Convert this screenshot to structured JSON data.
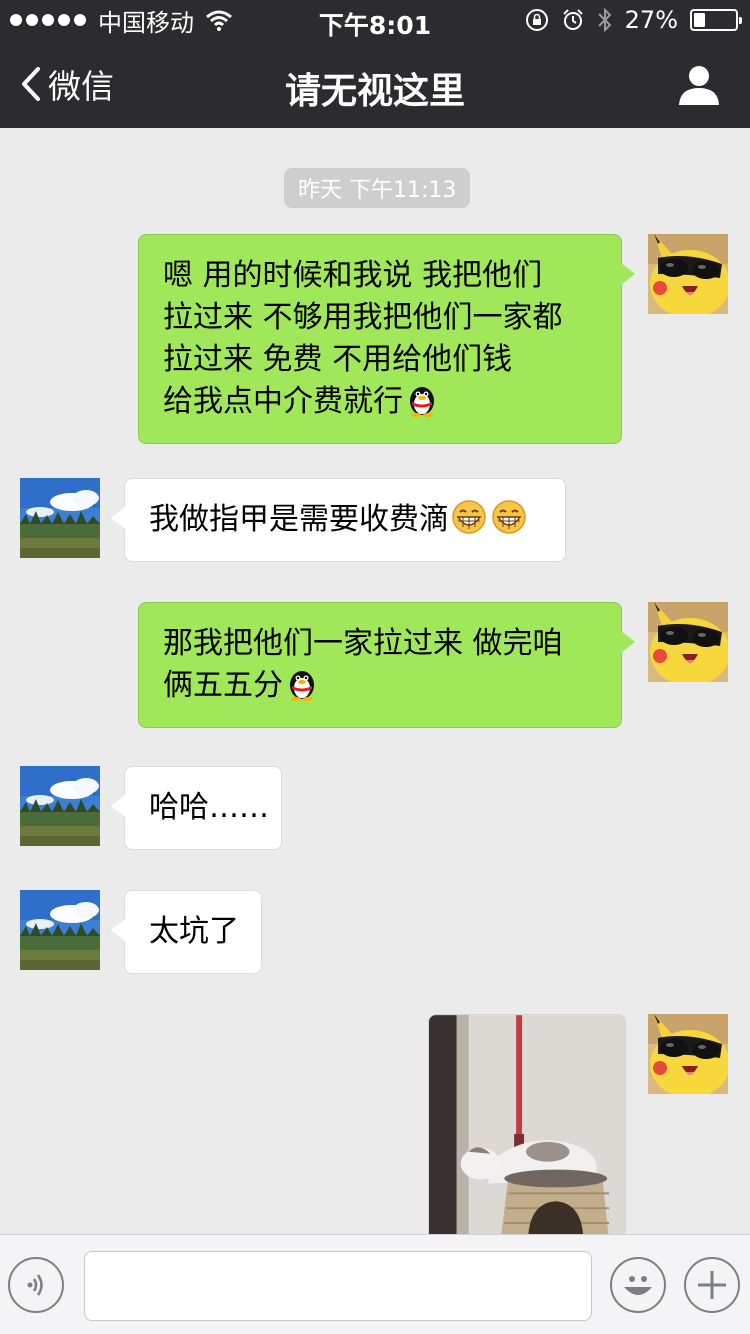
{
  "status_bar": {
    "carrier": "中国移动",
    "time": "下午8:01",
    "battery_text": "27%",
    "battery_level": 0.27
  },
  "nav": {
    "back_label": "微信",
    "title": "请无视这里"
  },
  "chat": {
    "timestamp": "昨天  下午11:13",
    "messages": [
      {
        "from": "me",
        "lines": [
          "嗯  用的时候和我说  我把他们",
          "拉过来  不够用我把他们一家都",
          "拉过来  免费   不用给他们钱",
          "给我点中介费就行"
        ],
        "emoji": "penguin-emoji"
      },
      {
        "from": "them",
        "lines": [
          "我做指甲是需要收费滴"
        ],
        "emoji": "grin-emoji"
      },
      {
        "from": "me",
        "lines": [
          "那我把他们一家拉过来 做完咱",
          "俩五五分"
        ],
        "emoji": "penguin-emoji"
      },
      {
        "from": "them",
        "lines": [
          "哈哈……"
        ]
      },
      {
        "from": "them",
        "lines": [
          "太坑了"
        ]
      },
      {
        "from": "me",
        "type": "image"
      }
    ]
  },
  "input_bar": {
    "value": "",
    "placeholder": ""
  },
  "colors": {
    "nav_bg": "#2c2c30",
    "chat_bg": "#ebebeb",
    "my_bubble": "#a0e75a",
    "their_bubble": "#ffffff"
  }
}
